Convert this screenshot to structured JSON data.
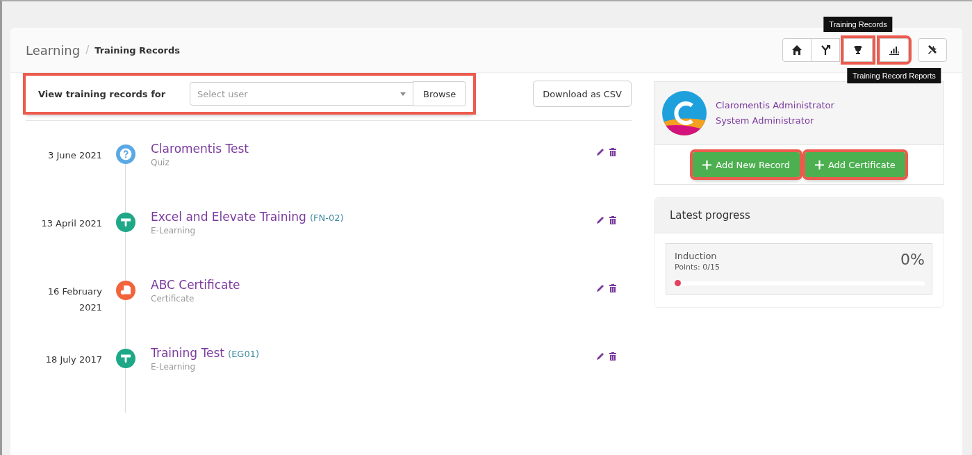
{
  "breadcrumb_separator": "/",
  "breadcrumb": [
    {
      "label": "Learning",
      "current": false
    },
    {
      "label": "Training Records",
      "current": true
    }
  ],
  "toolbar": [
    {
      "kind": "home",
      "highlighted": false
    },
    {
      "kind": "fork",
      "highlighted": false
    },
    {
      "kind": "trophy",
      "highlighted": true,
      "tooltip_above": "Training Records"
    },
    {
      "kind": "chart",
      "highlighted": true,
      "tooltip_below": "Training Record Reports"
    },
    {
      "kind": "tools",
      "highlighted": false
    }
  ],
  "filter": {
    "label": "View training records for",
    "placeholder": "Select user",
    "button": "Browse",
    "highlighted": true
  },
  "download_button": "Download as CSV",
  "records": [
    {
      "date": "3 June 2021",
      "title": "Claromentis Test",
      "type": "Quiz",
      "kind": "quiz",
      "color": "#5aa9e6"
    },
    {
      "date": "13 April 2021",
      "title": "Excel and Elevate Training",
      "code": "(FN-02)",
      "type": "E-Learning",
      "kind": "elearning",
      "color": "#1fa887"
    },
    {
      "date": "16 February 2021",
      "title": "ABC Certificate",
      "type": "Certificate",
      "kind": "certificate",
      "color": "#f2643c"
    },
    {
      "date": "18 July 2017",
      "title": "Training Test",
      "code": "(EG01)",
      "type": "E-Learning",
      "kind": "elearning",
      "color": "#1fa887"
    }
  ],
  "profile": {
    "name": "Claromentis Administrator",
    "role": "System Administrator"
  },
  "actions": [
    {
      "label": "Add New Record",
      "highlighted": true
    },
    {
      "label": "Add Certificate",
      "highlighted": true
    }
  ],
  "progress": {
    "title": "Latest progress",
    "items": [
      {
        "name": "Induction",
        "points": "Points: 0/15",
        "percent": "0%",
        "level": 0
      }
    ]
  }
}
